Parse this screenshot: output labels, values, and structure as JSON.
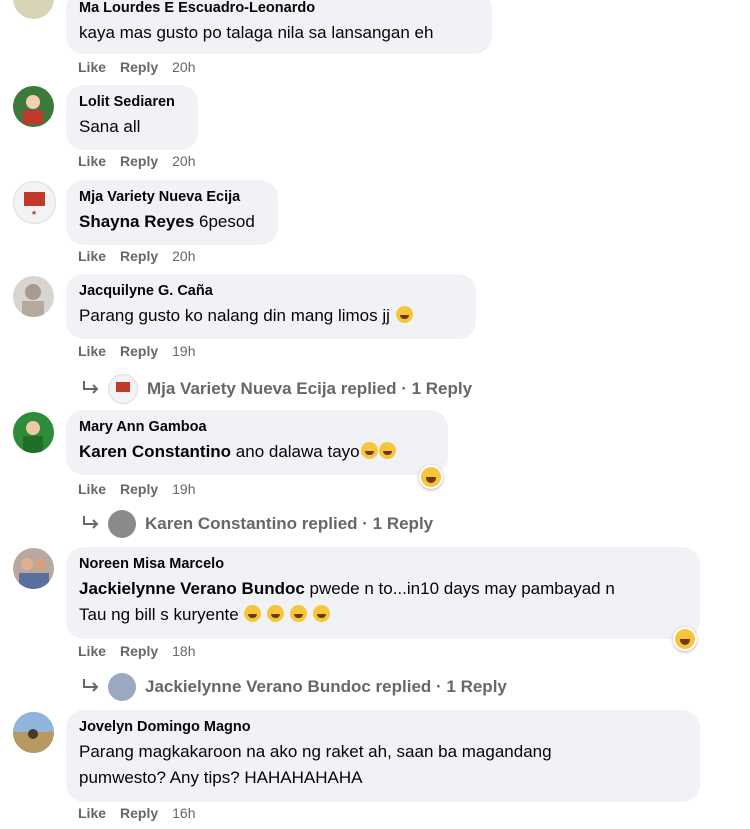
{
  "actions": {
    "like": "Like",
    "reply": "Reply"
  },
  "comments": [
    {
      "author": "Ma Lourdes E Escuadro-Leonardo",
      "text": "kaya mas gusto po talaga nila sa lansangan eh",
      "time": "20h"
    },
    {
      "author": "Lolit Sediaren",
      "text": "Sana all",
      "time": "20h"
    },
    {
      "author": "Mja Variety Nueva Ecija",
      "mention": "Shayna Reyes",
      "text": " 6pesod",
      "time": "20h"
    },
    {
      "author": "Jacquilyne G. Caña",
      "text": "Parang gusto ko nalang din mang limos jj",
      "time": "19h",
      "reply": {
        "name": "Mja Variety Nueva Ecija",
        "label": "replied · 1 Reply"
      }
    },
    {
      "author": "Mary Ann Gamboa",
      "mention": "Karen Constantino",
      "text": " ano dalawa tayo",
      "time": "19h",
      "reply": {
        "name": "Karen Constantino",
        "label": "replied · 1 Reply"
      }
    },
    {
      "author": "Noreen Misa Marcelo",
      "mention": "Jackielynne Verano Bundoc",
      "text": " pwede n to...in10 days may pambayad n",
      "text2": "Tau ng bill s kuryente ",
      "time": "18h",
      "reply": {
        "name": "Jackielynne Verano Bundoc",
        "label": "replied · 1 Reply"
      }
    },
    {
      "author": "Jovelyn Domingo Magno",
      "text": "Parang magkakaroon na ako ng raket ah, saan ba magandang",
      "text2": "pumwesto? Any tips? HAHAHAHAHA",
      "time": "16h"
    }
  ],
  "icons": {
    "reply_arrow": "reply-arrow-icon",
    "reaction": "haha-reaction-icon"
  },
  "colors": {
    "bubble": "#f0f2f5",
    "meta": "#65676b",
    "text": "#050505"
  }
}
